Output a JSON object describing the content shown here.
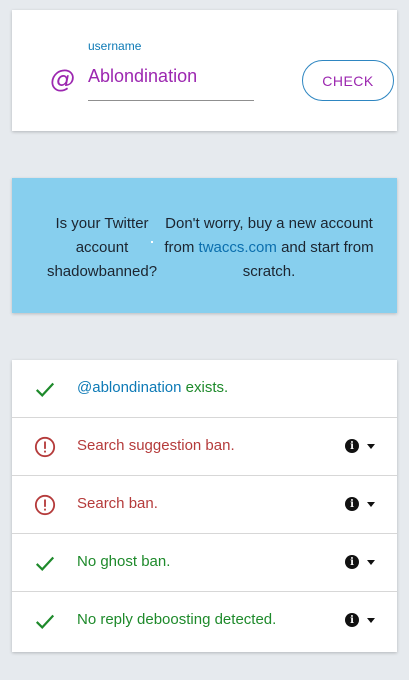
{
  "username_card": {
    "field_label": "username",
    "field_value": "Ablondination",
    "at_symbol": "@",
    "check_button": "CHECK"
  },
  "ad": {
    "left_text": "Is your Twitter account shadowbanned?",
    "right_prefix": "Don't worry, buy a new account from ",
    "link_text": "twaccs.com",
    "right_suffix": " and start from scratch."
  },
  "results": {
    "exists": {
      "user": "@ablondination",
      "text": " exists."
    },
    "rows": [
      {
        "text": "Search suggestion ban.",
        "status": "bad"
      },
      {
        "text": "Search ban.",
        "status": "bad"
      },
      {
        "text": "No ghost ban.",
        "status": "ok"
      },
      {
        "text": "No reply deboosting detected.",
        "status": "ok"
      }
    ],
    "info_glyph": "i"
  },
  "colors": {
    "accent_purple": "#9c27b0",
    "link_blue": "#0d7ab6",
    "ok_green": "#1e8a2b",
    "bad_red": "#b53b3b",
    "banner_blue": "#87cfee"
  }
}
